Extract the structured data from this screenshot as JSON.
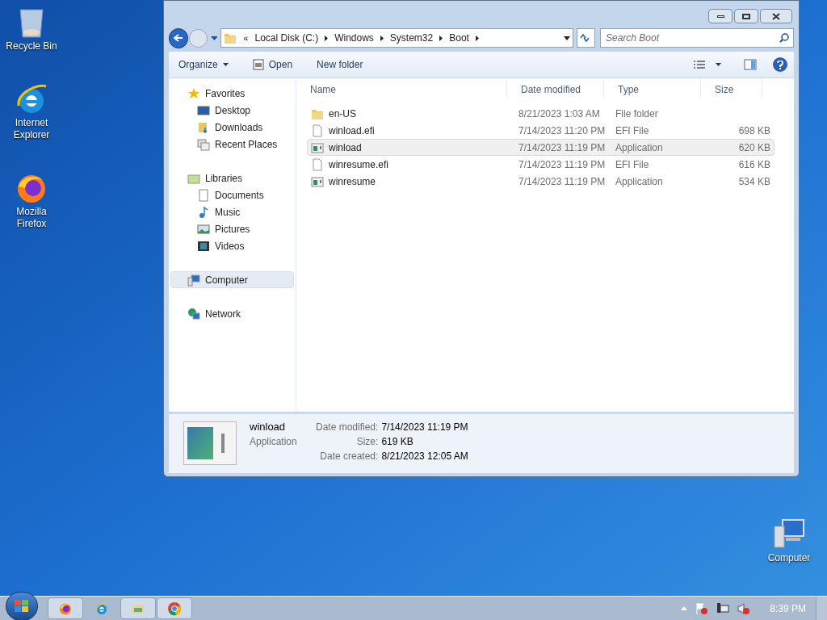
{
  "desktop_icons": [
    {
      "label": "Recycle Bin",
      "kind": "recycle"
    },
    {
      "label": "Internet Explorer",
      "kind": "ie"
    },
    {
      "label": "Mozilla Firefox",
      "kind": "firefox"
    },
    {
      "label": "Computer",
      "kind": "computer"
    }
  ],
  "window": {
    "address": {
      "overflow": "«",
      "segments": [
        "Local Disk (C:)",
        "Windows",
        "System32",
        "Boot"
      ]
    },
    "search": {
      "placeholder": "Search Boot"
    },
    "toolbar": [
      {
        "label": "Organize",
        "kind": "menu"
      },
      {
        "label": "Open",
        "kind": "open"
      },
      {
        "label": "New folder",
        "kind": "plain"
      }
    ],
    "nav": [
      {
        "label": "Favorites",
        "kind": "star",
        "selected": false,
        "children": [
          {
            "label": "Desktop",
            "kind": "desktop",
            "selected": false
          },
          {
            "label": "Downloads",
            "kind": "downloads",
            "selected": false
          },
          {
            "label": "Recent Places",
            "kind": "recent",
            "selected": false
          }
        ]
      },
      {
        "label": "Libraries",
        "kind": "libraries",
        "selected": false,
        "children": [
          {
            "label": "Documents",
            "kind": "documents",
            "selected": false
          },
          {
            "label": "Music",
            "kind": "music",
            "selected": false
          },
          {
            "label": "Pictures",
            "kind": "pictures",
            "selected": false
          },
          {
            "label": "Videos",
            "kind": "videos",
            "selected": false
          }
        ]
      },
      {
        "label": "Computer",
        "kind": "computer",
        "selected": true
      },
      {
        "label": "Network",
        "kind": "network",
        "selected": false
      }
    ],
    "columns": [
      "Name",
      "Date modified",
      "Type",
      "Size"
    ],
    "files": [
      {
        "name": "en-US",
        "date": "8/21/2023 1:03 AM",
        "type": "File folder",
        "kind": "folder",
        "selected": false
      },
      {
        "name": "winload.efi",
        "date": "7/14/2023 11:20 PM",
        "type": "EFI File",
        "size": "698 KB",
        "kind": "file",
        "selected": false
      },
      {
        "name": "winload",
        "date": "7/14/2023 11:19 PM",
        "type": "Application",
        "size": "620 KB",
        "kind": "app",
        "selected": true
      },
      {
        "name": "winresume.efi",
        "date": "7/14/2023 11:19 PM",
        "type": "EFI File",
        "size": "616 KB",
        "kind": "file",
        "selected": false
      },
      {
        "name": "winresume",
        "date": "7/14/2023 11:19 PM",
        "type": "Application",
        "size": "534 KB",
        "kind": "app",
        "selected": false
      }
    ],
    "details": {
      "name": "winload",
      "type": "Application",
      "fields": [
        {
          "label": "Date modified:",
          "value": "7/14/2023 11:19 PM"
        },
        {
          "label": "Size:",
          "value": "619 KB"
        },
        {
          "label": "Date created:",
          "value": "8/21/2023 12:05 AM"
        }
      ]
    }
  },
  "taskbar": {
    "apps": [
      {
        "kind": "firefox",
        "running": true
      },
      {
        "kind": "ie",
        "running": false
      },
      {
        "kind": "explorer",
        "running": true
      },
      {
        "kind": "chrome",
        "running": true
      }
    ],
    "clock": "8:39 PM"
  }
}
